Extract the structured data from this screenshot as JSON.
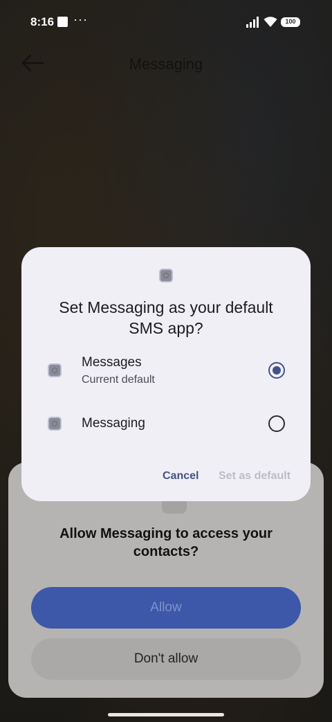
{
  "status_bar": {
    "time": "8:16",
    "dots": "···",
    "battery": "100"
  },
  "toolbar": {
    "title": "Messaging",
    "back_icon": "arrow-left-icon"
  },
  "permission_dialog": {
    "title": "Allow Messaging to access your contacts?",
    "allow_label": "Allow",
    "deny_label": "Don't allow",
    "icon": "contacts-icon"
  },
  "default_sms_dialog": {
    "title": "Set Messaging as your default SMS app?",
    "options": [
      {
        "label": "Messages",
        "sublabel": "Current default",
        "selected": true
      },
      {
        "label": "Messaging",
        "selected": false
      }
    ],
    "cancel_label": "Cancel",
    "set_default_label": "Set as default"
  },
  "colors": {
    "accent": "#435288",
    "allow_button": "#3d58a8",
    "dialog_bg": "#f1eff6"
  }
}
